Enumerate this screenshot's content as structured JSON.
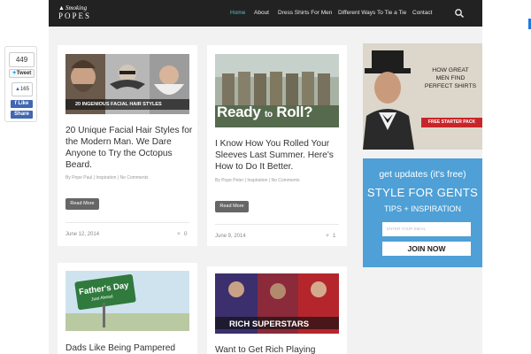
{
  "brand": {
    "logo_line1": "Smoking",
    "logo_line2": "POPES"
  },
  "nav": {
    "items": [
      {
        "label": "Home",
        "active": true
      },
      {
        "label": "About",
        "active": false
      },
      {
        "label": "Dress Shirts For Men",
        "active": false
      },
      {
        "label": "Different Ways To Tie a Tie",
        "active": false
      },
      {
        "label": "Contact",
        "active": false
      }
    ],
    "search_icon": "search-icon"
  },
  "share": {
    "total_count": "449",
    "tweet_label": "Tweet",
    "fb_count": "165",
    "like_label": "Like",
    "share_label": "Share"
  },
  "posts": [
    {
      "image_caption": "20 INGENIOUS FACIAL HAIR STYLES",
      "title": "20 Unique Facial Hair Styles for the Modern Man. We Dare Anyone to Try the Octopus Beard.",
      "author": "By Pope Paul",
      "category": "Inspiration",
      "comments": "No Comments",
      "read_more": "Read More",
      "date": "June 12, 2014",
      "likes": "0"
    },
    {
      "image_caption_1": "Ready",
      "image_caption_2": "to",
      "image_caption_3": "Roll?",
      "title": "I Know How You Rolled Your Sleeves Last Summer. Here's How to Do It Better.",
      "author": "By Pope Peter",
      "category": "Inspiration",
      "comments": "No Comments",
      "read_more": "Read More",
      "date": "June 9, 2014",
      "likes": "1"
    },
    {
      "image_caption_1": "Father's Day",
      "image_caption_2": "Just Ahead",
      "title": "Dads Like Being Pampered"
    },
    {
      "image_caption": "RICH SUPERSTARS",
      "title": "Want to Get Rich Playing"
    }
  ],
  "ads": {
    "shirt_ad": {
      "line1": "HOW GREAT",
      "line2": "MEN FIND",
      "line3": "PERFECT SHIRTS",
      "cta": "FREE STARTER PACK"
    },
    "newsletter": {
      "heading": "get updates (it's free)",
      "title": "STYLE FOR GENTS",
      "subtitle": "TIPS + INSPIRATION",
      "email_placeholder": "ENTER YOUR EMAIL",
      "join_label": "JOIN NOW"
    }
  },
  "colors": {
    "nav_bg": "#222222",
    "nav_active": "#5ac0c6",
    "newsletter_bg": "#4ea0d6",
    "ad_red": "#c8252b",
    "fb_blue": "#4267b2"
  }
}
